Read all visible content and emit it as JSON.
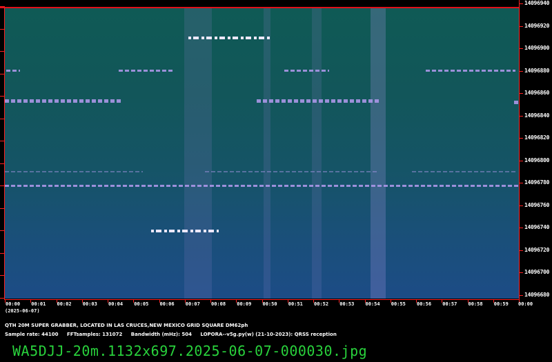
{
  "frequency_labels": [
    "14096940",
    "14096920",
    "14096900",
    "14096880",
    "14096860",
    "14096840",
    "14096820",
    "14096800",
    "14096780",
    "14096760",
    "14096740",
    "14096720",
    "14096700",
    "14096680"
  ],
  "time_labels": [
    "00:00",
    "00:01",
    "00:02",
    "00:03",
    "00:04",
    "00:05",
    "00:06",
    "00:07",
    "00:08",
    "00:09",
    "00:50",
    "00:51",
    "00:52",
    "00:53",
    "00:54",
    "00:55",
    "00:56",
    "00:57",
    "00:58",
    "00:59",
    "00:00"
  ],
  "date": "(2025-06-07)",
  "info": {
    "qth": "QTH 20M SUPER GRABBER, LOCATED IN LAS CRUCES,NEW MEXICO GRID SQUARE DM62ph",
    "sample_rate": "Sample rate: 44100",
    "fft_samples": "FFTsamples: 131072",
    "bandwidth": "Bandwidth (mHz): 504",
    "software": "LOPORA--v5g.py(w) (21-10-2023): QRSS reception"
  },
  "filename": "WA5DJJ-20m.1132x697.2025-06-07-000030.jpg",
  "colors": {
    "axis": "#ff2020",
    "filename": "#29d23c",
    "background_top": "#0f5a55",
    "background_bottom": "#1c4c86",
    "signal": "#aa96e6"
  }
}
